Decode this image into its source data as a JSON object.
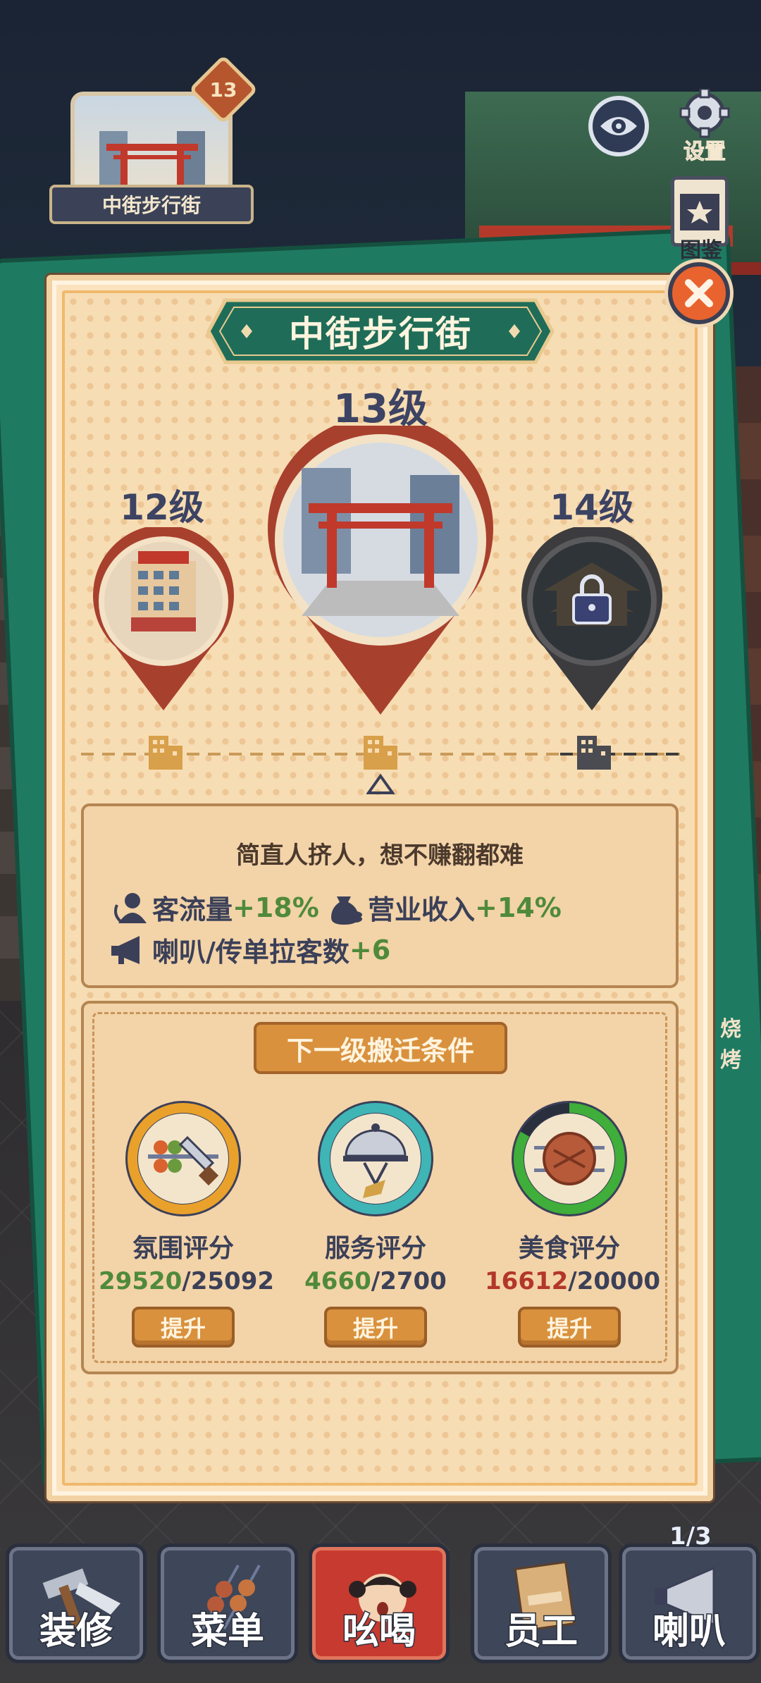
{
  "location_badge": {
    "count": "13",
    "name": "中街步行街"
  },
  "top_buttons": {
    "settings_label": "设置",
    "album_label": "图鉴"
  },
  "panel": {
    "title": "中街步行街",
    "levels": [
      {
        "label": "12级",
        "state": "passed"
      },
      {
        "label": "13级",
        "state": "current"
      },
      {
        "label": "14级",
        "state": "locked"
      }
    ],
    "description": "简直人挤人，想不赚翻都难",
    "stats": [
      {
        "name": "客流量",
        "value": "+18%",
        "icon": "customers-icon"
      },
      {
        "name": "营业收入",
        "value": "+14%",
        "icon": "money-bag-icon"
      },
      {
        "name": "喇叭/传单拉客数",
        "value": "+6",
        "icon": "megaphone-icon"
      }
    ],
    "conditions_title": "下一级搬迁条件",
    "scores": [
      {
        "name": "氛围评分",
        "current": "29520",
        "target": "25092",
        "progress": 1.0,
        "color": "#e9a12c",
        "met": true,
        "button": "提升",
        "icon": "skewers-brush-icon"
      },
      {
        "name": "服务评分",
        "current": "4660",
        "target": "2700",
        "progress": 1.0,
        "color": "#3fb5b5",
        "met": true,
        "button": "提升",
        "icon": "cloche-icon"
      },
      {
        "name": "美食评分",
        "current": "16612",
        "target": "20000",
        "progress": 0.83,
        "color": "#3fae3a",
        "met": false,
        "button": "提升",
        "icon": "grilled-meat-icon"
      }
    ]
  },
  "side": {
    "shop_label": "烧烤"
  },
  "bottom_nav": {
    "items": [
      {
        "label": "装修",
        "icon": "hammer-saw-icon"
      },
      {
        "label": "菜单",
        "icon": "skewers-icon"
      },
      {
        "label": "吆喝",
        "icon": "girl-shouting-icon"
      },
      {
        "label": "员工",
        "icon": "staff-file-icon"
      },
      {
        "label": "喇叭",
        "icon": "megaphone-icon"
      }
    ],
    "page_indicator": "1/3"
  }
}
